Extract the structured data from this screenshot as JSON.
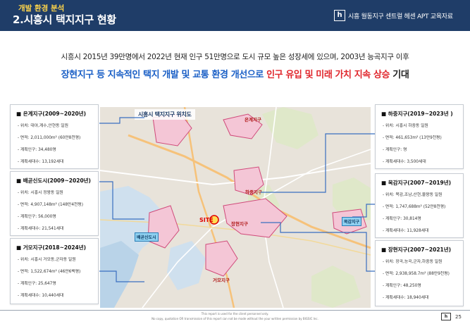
{
  "header": {
    "category": "개발 환경 분석",
    "title": "2.시흥시 택지지구 현황",
    "logo_glyph": "h",
    "brand": "시흥 월동지구 센트럴 헤센 APT 교육자료"
  },
  "lead": {
    "line1": "시흥시 2015년 39만명에서 2022년 현재 인구 51만명으로 도시 규모 높은 성장세에 있으며, 2003년 능곡지구 이후",
    "line2_blue": "장현지구 등 지속적인 택지 개발 및 교통 환경 개선으로",
    "line2_red": "인구 유입 및 미래 가치 지속 상승",
    "line2_end": "기대"
  },
  "map": {
    "title": "시흥시 택지지구 위치도",
    "labels": {
      "eungye": "은계지구",
      "hajung": "하중지구",
      "site": "SITE",
      "janghyeon": "장현지구",
      "mokgam": "목감지구",
      "baegot": "배곧신도시",
      "geomo": "거모지구"
    }
  },
  "districts": {
    "eungye": {
      "title": "■ 은계지구(2009~2020년)",
      "location": "- 위치: 대야,계수,안현동 일원",
      "area": "- 면적: 2,011,000m² (60만8천평)",
      "population": "- 계획인구: 34,480명",
      "households": "- 계획세대수: 13,192세대"
    },
    "baegot": {
      "title": "■ 배곧신도시(2009~2020년)",
      "location": "- 위치: 시흥시 정왕동 일원",
      "area": "- 면적: 4,907,148m² (148만4천평)",
      "population": "- 계획인구: 56,000명",
      "households": "- 계획세대수: 21,541세대"
    },
    "geomo": {
      "title": "■ 거모지구(2018~2024년)",
      "location": "- 위치: 시흥시 거모동,군자동 일원",
      "area": "- 면적: 1,522,674m² (46만6백평)",
      "population": "- 계획인구: 25,647명",
      "households": "- 계획세대수: 10,440세대"
    },
    "hajung": {
      "title": "■ 하중지구(2019~2023년 )",
      "location": "- 위치: 시흥시 하중동 일원",
      "area": "- 면적: 461,653m² (13만9천평)",
      "population": "- 계획인구: 명",
      "households": "- 계획세대수: 3,500세대"
    },
    "mokgam": {
      "title": "■ 목감지구(2007~2019년)",
      "location": "- 위치: 목감,조남,산현,물왕동 일원",
      "area": "- 면적: 1,747,688m² (52만8천평)",
      "population": "- 계획인구: 30,814명",
      "households": "- 계획세대수: 11,928세대"
    },
    "janghyeon": {
      "title": "■ 장현지구(2007~2021년)",
      "location": "- 위치: 장곡,능곡,군자,하중동 일원",
      "area": "- 면적: 2,938,958.7m² (88만9천평)",
      "population": "- 계획인구: 48,250명",
      "households": "- 계획세대수: 18,940세대"
    }
  },
  "footer": {
    "line1": "This report is used for the client personnel only.",
    "line2": "No copy, quotation OR transmission of this report can not be made without the your written permission by BIGSIC Inc.",
    "logo_glyph": "h",
    "page": "25"
  },
  "colors": {
    "header_bg": "#1f3d68",
    "category_text": "#ffd54a",
    "accent_blue": "#1a5fc6",
    "accent_red": "#e0262c",
    "connector_blue": "#3a6fc0"
  }
}
